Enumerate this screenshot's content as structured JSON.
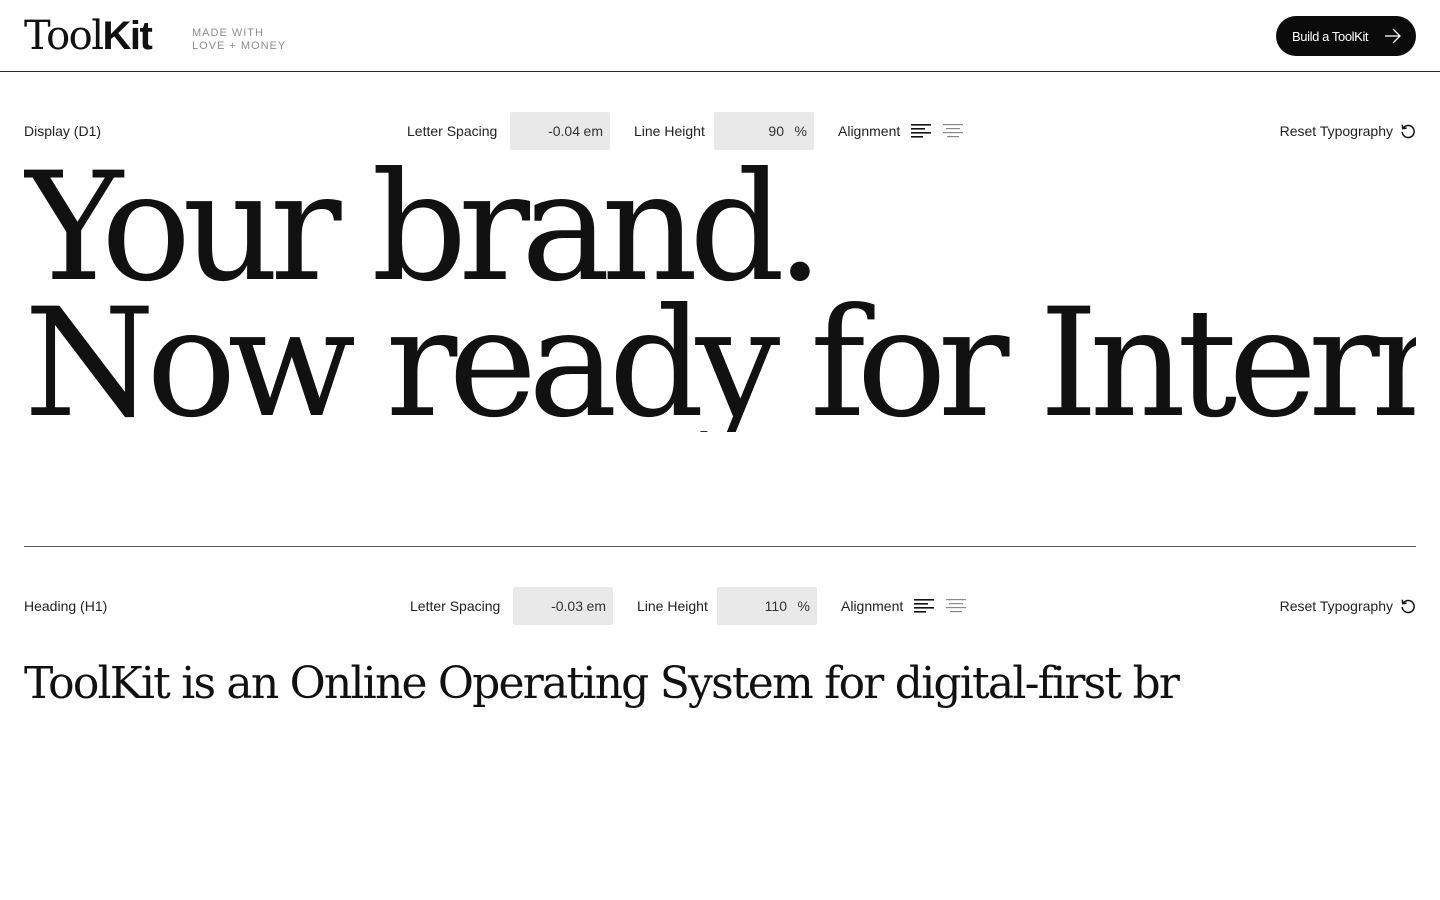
{
  "header": {
    "logo_light": "Tool",
    "logo_bold": "Kit",
    "tagline_line1": "MADE WITH",
    "tagline_line2": "LOVE + MONEY",
    "cta_label": "Build a ToolKit",
    "cta_icon": "arrow-right-icon"
  },
  "sections": [
    {
      "label": "Display (D1)",
      "letter_spacing_label": "Letter Spacing",
      "letter_spacing_value": "-0.04",
      "letter_spacing_unit": "em",
      "line_height_label": "Line Height",
      "line_height_value": "90",
      "line_height_unit": "%",
      "alignment_label": "Alignment",
      "alignment_options": [
        "align-left-icon",
        "align-center-icon"
      ],
      "alignment_selected": "left",
      "reset_label": "Reset Typography",
      "reset_icon": "reset-icon",
      "preview_lines": [
        "Your brand.",
        "Now ready for Intern"
      ]
    },
    {
      "label": "Heading (H1)",
      "letter_spacing_label": "Letter Spacing",
      "letter_spacing_value": "-0.03",
      "letter_spacing_unit": "em",
      "line_height_label": "Line Height",
      "line_height_value": "110",
      "line_height_unit": "%",
      "alignment_label": "Alignment",
      "alignment_options": [
        "align-left-icon",
        "align-center-icon"
      ],
      "alignment_selected": "left",
      "reset_label": "Reset Typography",
      "reset_icon": "reset-icon",
      "preview_text": "ToolKit is an Online Operating System for digital-first br"
    }
  ],
  "colors": {
    "ink": "#111111",
    "button_bg": "#0b0b0b",
    "field_bg": "#e9e9e9",
    "muted": "#8d8d8d"
  }
}
